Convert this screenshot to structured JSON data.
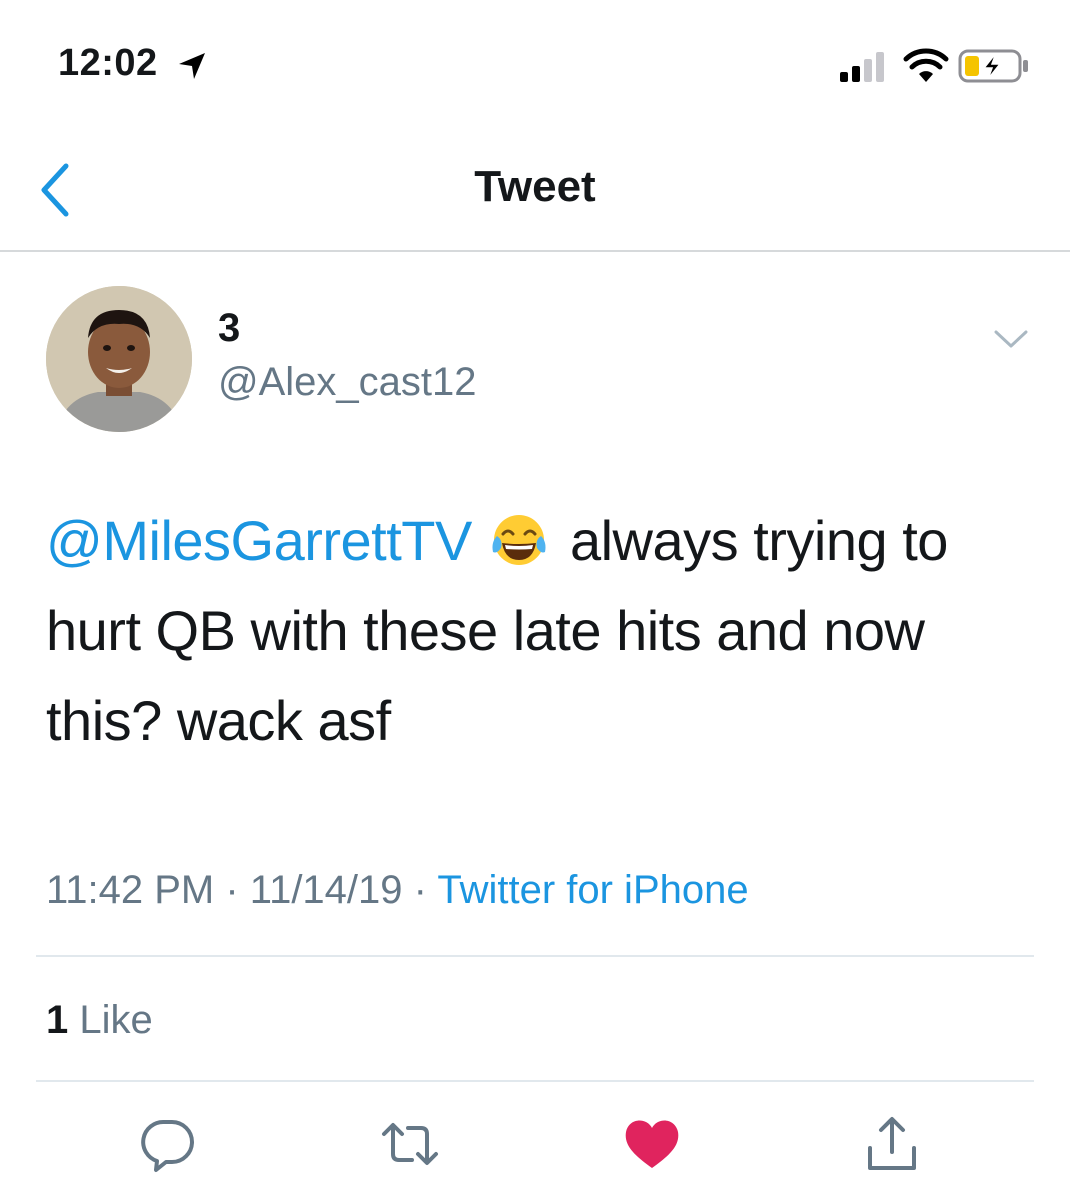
{
  "status_bar": {
    "time": "12:02",
    "icons": [
      "location-arrow-icon",
      "signal-icon",
      "wifi-icon",
      "battery-charging-icon"
    ]
  },
  "nav": {
    "title": "Tweet",
    "back_icon": "chevron-left-icon"
  },
  "tweet": {
    "display_name": "3",
    "handle": "@Alex_cast12",
    "mention": "@MilesGarrettTV",
    "emoji_icon": "face-with-tears-of-joy-icon",
    "text_after_emoji": " always trying to hurt QB with these late hits and now this? wack asf",
    "time": "11:42 PM",
    "date": "11/14/19",
    "separator": " · ",
    "source": "Twitter for iPhone",
    "like_count": "1",
    "like_label": " Like"
  },
  "actions": {
    "icons": [
      "reply-icon",
      "retweet-icon",
      "heart-icon",
      "share-icon"
    ]
  },
  "colors": {
    "link": "#1b95e0",
    "secondary_text": "#657786",
    "primary_text": "#14171a",
    "like_active": "#e0245e"
  }
}
